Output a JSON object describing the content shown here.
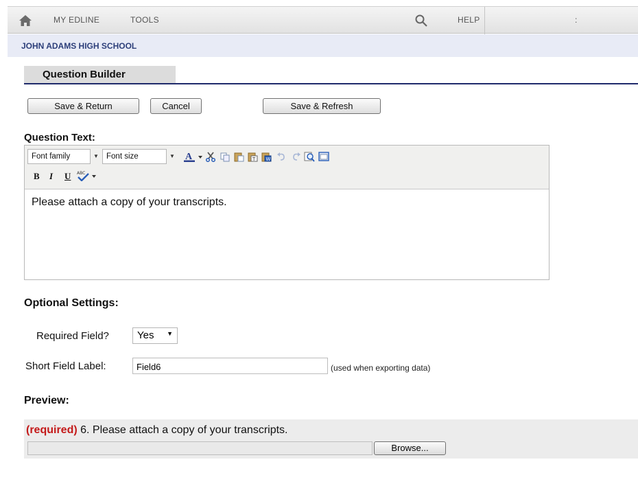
{
  "nav": {
    "home_icon": "home-icon",
    "items": [
      "MY EDLINE",
      "TOOLS"
    ],
    "search_icon": "search-icon",
    "help": "HELP",
    "account": ":"
  },
  "school": "JOHN ADAMS HIGH SCHOOL",
  "page": {
    "title": "Question Builder"
  },
  "actions": {
    "save_return": "Save & Return",
    "cancel": "Cancel",
    "save_refresh": "Save & Refresh"
  },
  "question": {
    "heading": "Question Text:",
    "font_family": "Font family",
    "font_size": "Font size",
    "toolbar_icons": [
      "font-color-icon",
      "cut-icon",
      "copy-icon",
      "paste-icon",
      "paste-text-icon",
      "paste-word-icon",
      "undo-icon",
      "redo-icon",
      "find-icon",
      "fullscreen-icon"
    ],
    "bold": "B",
    "italic": "I",
    "underline": "U",
    "spellcheck_icon": "spellcheck-icon",
    "text": "Please attach a copy of your transcripts."
  },
  "optional": {
    "heading": "Optional Settings:",
    "required_label": "Required Field?",
    "required_value": "Yes",
    "short_label": "Short Field Label:",
    "short_value": "Field6",
    "short_hint": "(used when exporting data)"
  },
  "preview": {
    "heading": "Preview:",
    "required_tag": "(required)",
    "question_line": " 6. Please attach a copy of your transcripts.",
    "browse": "Browse..."
  },
  "colors": {
    "school_text": "#2d3f7a",
    "title_rule": "#1f2a6b",
    "required": "#c41a1a"
  }
}
